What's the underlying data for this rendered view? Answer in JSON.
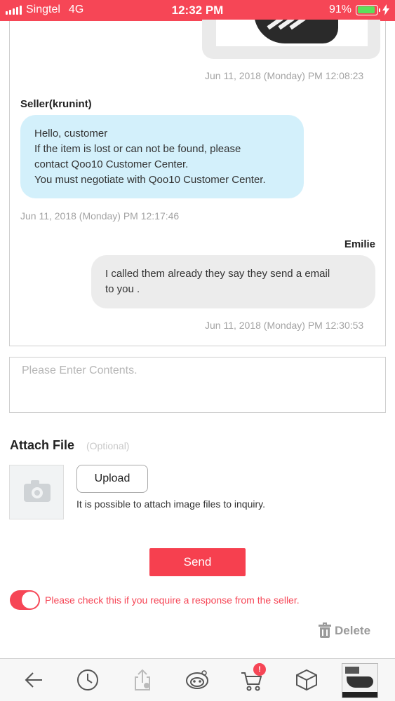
{
  "status_bar": {
    "carrier": "Singtel",
    "network": "4G",
    "time": "12:32 PM",
    "battery": "91%",
    "battery_level": 0.91,
    "background": "#f64656"
  },
  "chat": {
    "image_message": {
      "timestamp": "Jun 11, 2018 (Monday) PM 12:08:23"
    },
    "seller_message": {
      "sender": "Seller(krunint)",
      "lines": [
        "Hello, customer",
        "If the item is lost or can not be found, please",
        "contact Qoo10 Customer Center.",
        "You must negotiate with Qoo10 Customer Center."
      ],
      "timestamp": "Jun 11, 2018 (Monday) PM 12:17:46"
    },
    "buyer_message": {
      "sender": "Emilie",
      "lines": [
        "I called them already they say they send a email",
        "to you ."
      ],
      "timestamp": "Jun 11, 2018 (Monday) PM 12:30:53"
    }
  },
  "compose": {
    "placeholder": "Please Enter Contents.",
    "value": ""
  },
  "attach": {
    "title": "Attach File",
    "optional": "(Optional)",
    "upload_label": "Upload",
    "help": "It is possible to attach image files to inquiry."
  },
  "send_label": "Send",
  "response_toggle": {
    "label": "Please check this if you require a response from the seller.",
    "checked": true
  },
  "delete_label": "Delete",
  "bottom_nav": {
    "icons": [
      "back-arrow-icon",
      "history-clock-icon",
      "share-icon",
      "qoo-mascot-icon",
      "cart-icon",
      "package-box-icon",
      "recent-item-thumbnail"
    ],
    "cart_badge": "!"
  },
  "colors": {
    "accent": "#f64656",
    "seller_bubble": "#d3f0fb",
    "buyer_bubble": "#ececec"
  }
}
